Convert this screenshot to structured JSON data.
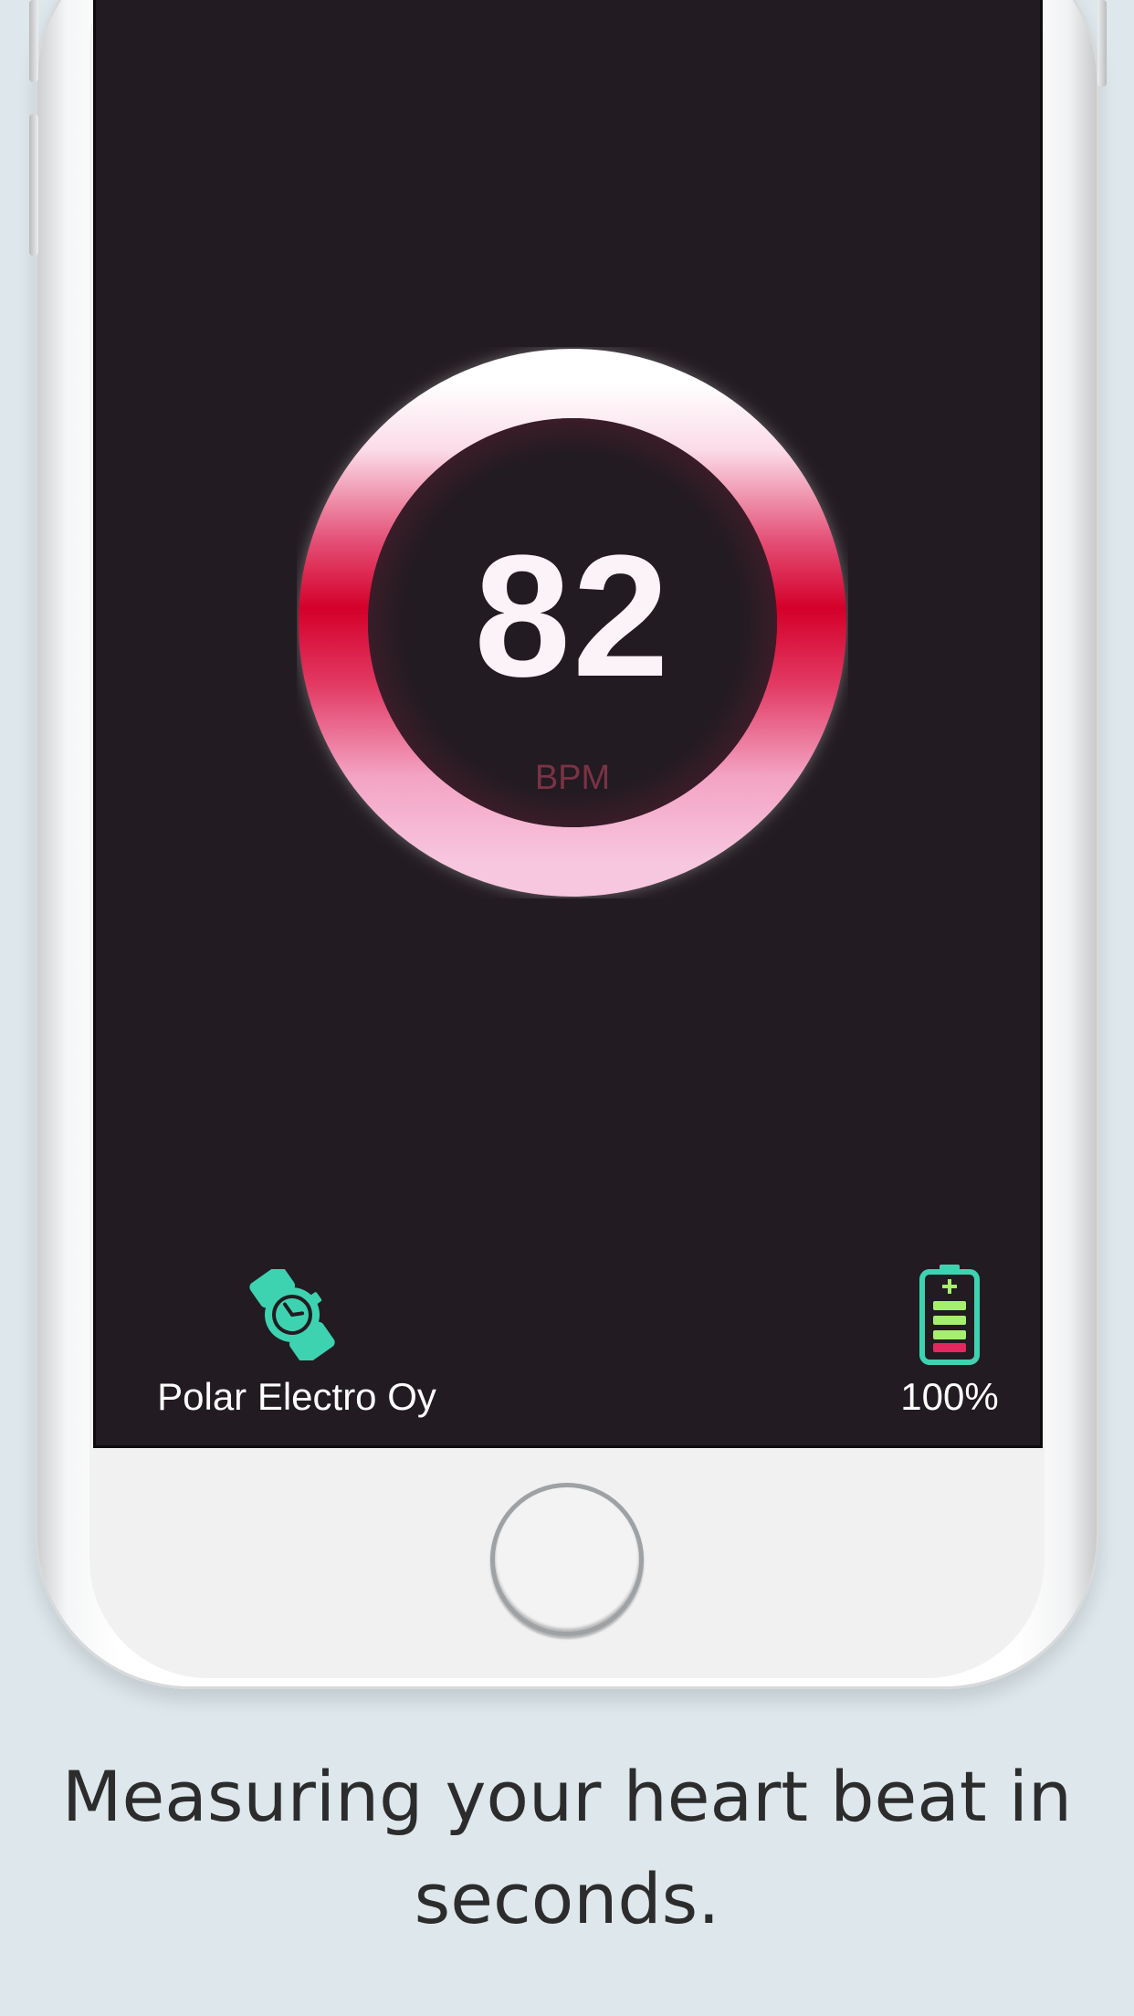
{
  "heart_rate": {
    "value": "82",
    "unit": "BPM"
  },
  "device": {
    "icon": "watch-icon",
    "name": "Polar Electro Oy"
  },
  "battery": {
    "icon": "battery-icon",
    "level": "100%"
  },
  "caption": "Measuring your heart beat in seconds.",
  "colors": {
    "background": "#dde7ec",
    "screen": "#221b21",
    "ring_red": "#d4002a",
    "ring_pink": "#f7bfd9",
    "accent_teal": "#3dd3b0",
    "battery_green": "#a6ef6e",
    "battery_red": "#e3285f",
    "bpm_label": "#7a3245"
  }
}
